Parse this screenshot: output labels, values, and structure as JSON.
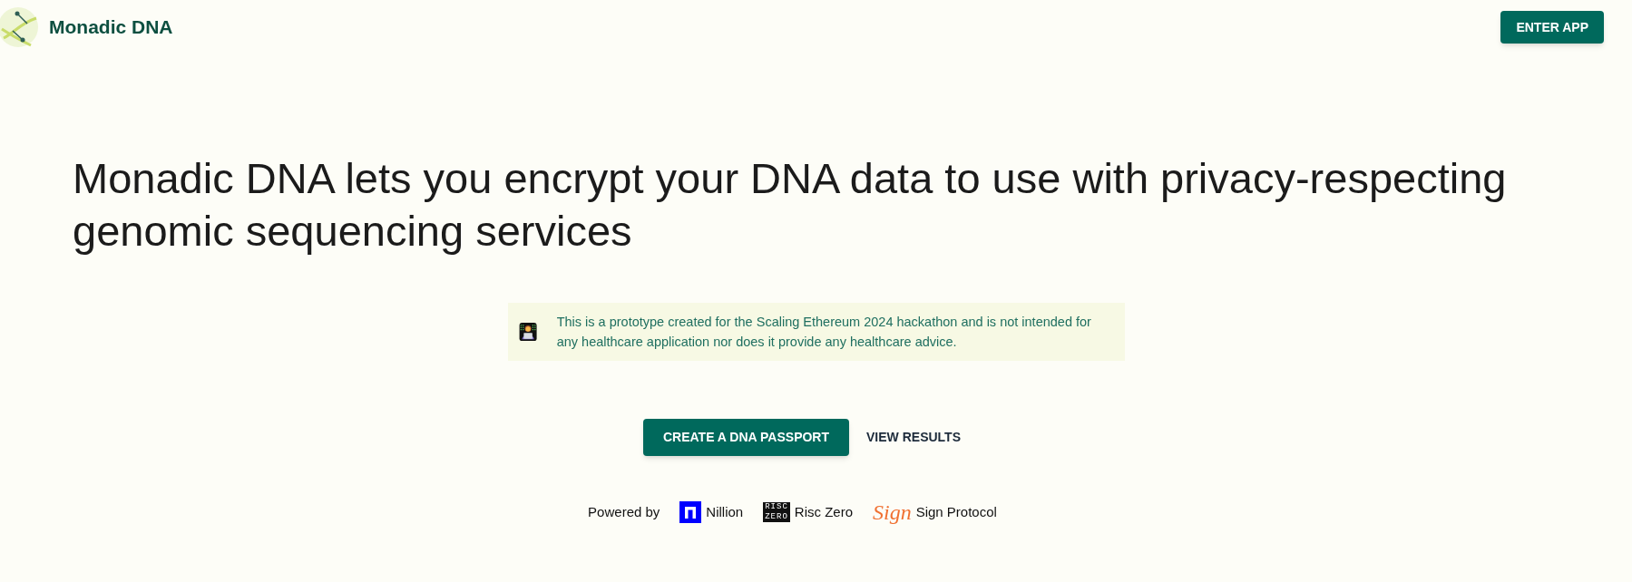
{
  "header": {
    "brand": "Monadic DNA",
    "enter_button": "ENTER APP"
  },
  "headline": "Monadic DNA lets you encrypt your DNA data to use with privacy-respecting genomic sequencing services",
  "notice": "This is a prototype created for the Scaling Ethereum 2024 hackathon and is not intended for any healthcare application nor does it provide any healthcare advice.",
  "actions": [
    {
      "label": "CREATE A DNA PASSPORT",
      "kind": "primary"
    },
    {
      "label": "VIEW RESULTS",
      "kind": "text"
    }
  ],
  "powered_by": {
    "label": "Powered by",
    "partners": [
      {
        "kind": "nillion",
        "name": "Nillion"
      },
      {
        "kind": "risc",
        "logo_text": [
          "RISC",
          "ZERO"
        ],
        "name": "Risc Zero"
      },
      {
        "kind": "sign",
        "logo_text": [
          "Sign"
        ],
        "name": "Sign Protocol"
      }
    ]
  }
}
